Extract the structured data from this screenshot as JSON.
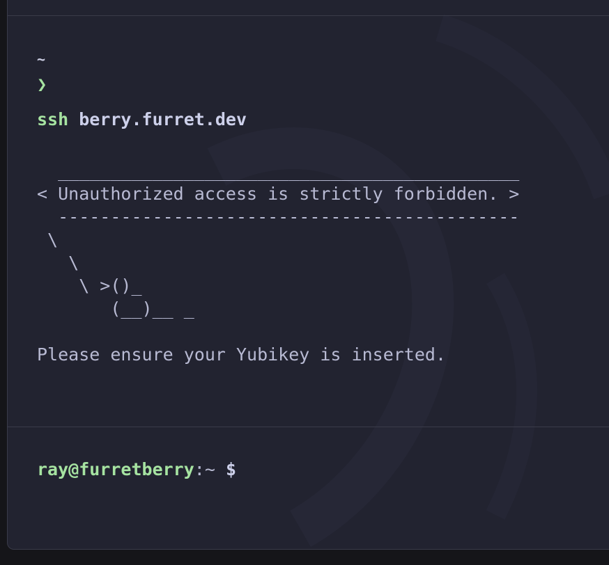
{
  "terminal": {
    "previous_block": {
      "cwd": "~",
      "prompt_symbol": "❯",
      "command": "ssh",
      "argument": "berry.furret.dev",
      "output": "  ____________________________________________\n< Unauthorized access is strictly forbidden. >\n  --------------------------------------------\n \\\n   \\\n    \\ >()_\n       (__)__ _\n\nPlease ensure your Yubikey is inserted."
    },
    "prompt": {
      "user_host": "ray@furretberry",
      "path": ":~",
      "symbol": " $"
    }
  },
  "colors": {
    "background": "#222330",
    "accent_green": "#a6e3a1",
    "text": "#b8bad3"
  }
}
